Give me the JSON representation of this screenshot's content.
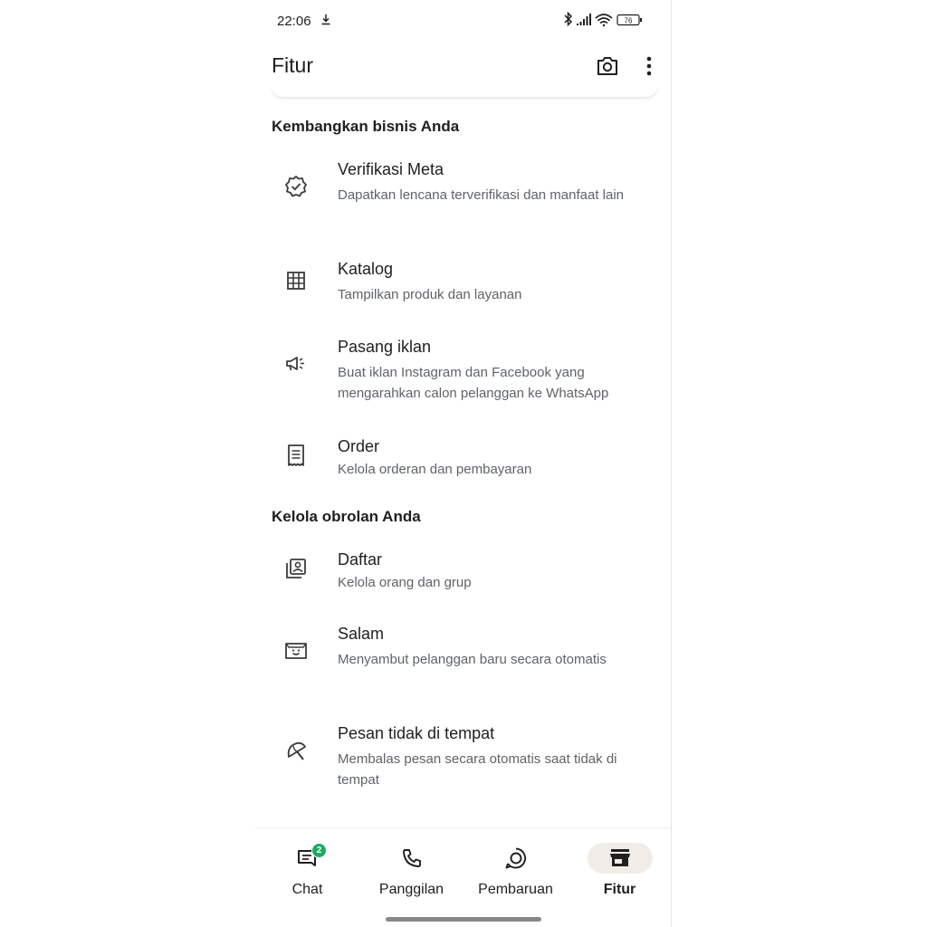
{
  "status": {
    "time": "22:06",
    "battery": "76"
  },
  "app_bar": {
    "title": "Fitur"
  },
  "sections": [
    {
      "title": "Kembangkan bisnis Anda",
      "items": [
        {
          "icon": "verified-badge-icon",
          "title": "Verifikasi Meta",
          "desc": "Dapatkan lencana terverifikasi dan manfaat lain"
        },
        {
          "icon": "catalog-grid-icon",
          "title": "Katalog",
          "desc": "Tampilkan produk dan layanan"
        },
        {
          "icon": "megaphone-icon",
          "title": "Pasang iklan",
          "desc": "Buat iklan Instagram dan Facebook yang mengarahkan calon pelanggan ke WhatsApp"
        },
        {
          "icon": "receipt-icon",
          "title": "Order",
          "desc": "Kelola orderan dan pembayaran"
        }
      ]
    },
    {
      "title": "Kelola obrolan Anda",
      "items": [
        {
          "icon": "contact-list-icon",
          "title": "Daftar",
          "desc": "Kelola orang dan grup"
        },
        {
          "icon": "greeting-message-icon",
          "title": "Salam",
          "desc": "Menyambut pelanggan baru secara otomatis"
        },
        {
          "icon": "away-beach-umbrella-icon",
          "title": "Pesan tidak di tempat",
          "desc": "Membalas pesan secara otomatis saat tidak di tempat"
        }
      ]
    }
  ],
  "bottom_nav": {
    "chat": {
      "label": "Chat",
      "badge": "2"
    },
    "calls": {
      "label": "Panggilan"
    },
    "updates": {
      "label": "Pembaruan"
    },
    "tools": {
      "label": "Fitur"
    }
  },
  "colors": {
    "accent_green": "#1daa61",
    "active_pill": "#f1ece7",
    "secondary_text": "#5f6368"
  }
}
